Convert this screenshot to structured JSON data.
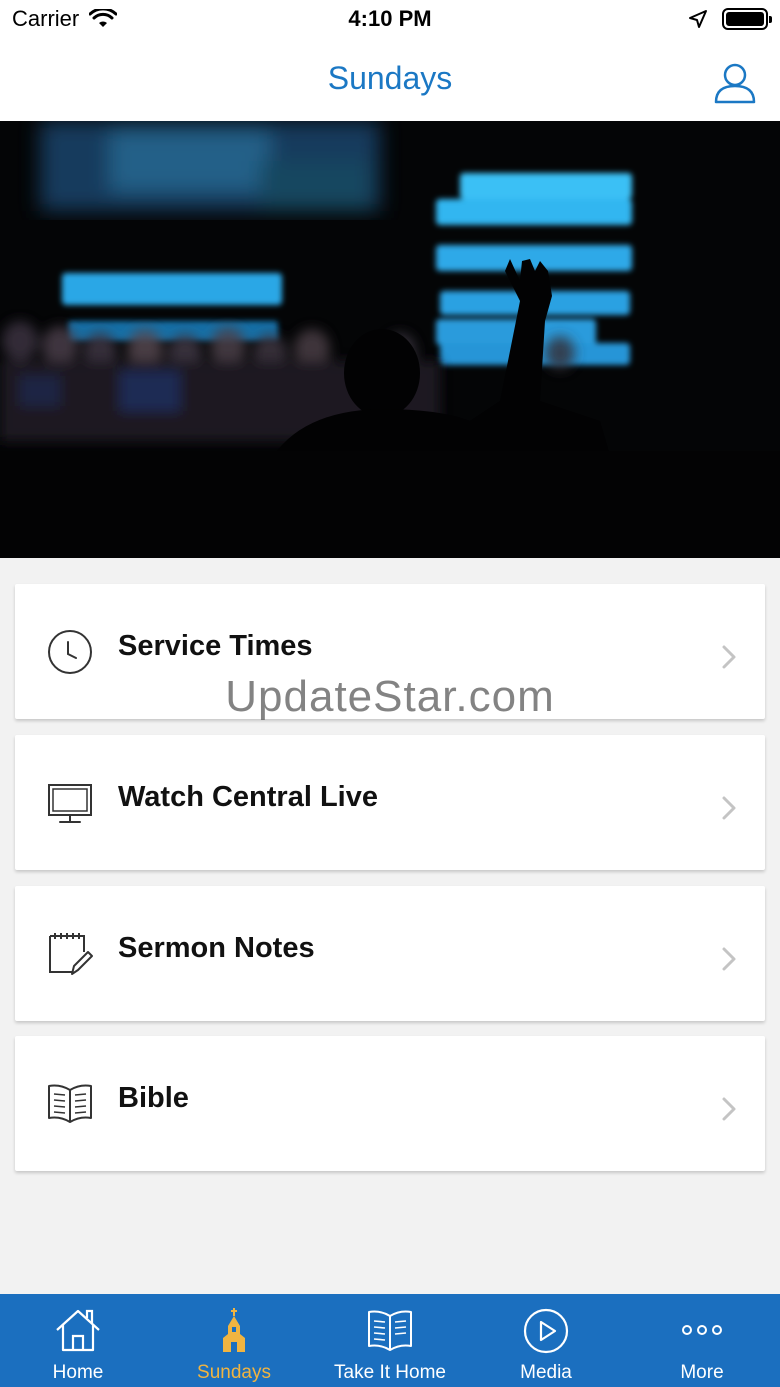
{
  "status_bar": {
    "carrier": "Carrier",
    "time": "4:10 PM"
  },
  "nav": {
    "title": "Sundays"
  },
  "hero": {
    "description": ""
  },
  "menu": [
    {
      "label": "Service Times",
      "icon": "clock-icon"
    },
    {
      "label": "Watch Central Live",
      "icon": "monitor-icon"
    },
    {
      "label": "Sermon Notes",
      "icon": "notepad-pencil-icon"
    },
    {
      "label": "Bible",
      "icon": "open-book-icon"
    }
  ],
  "watermark": "UpdateStar.com",
  "tabs": [
    {
      "label": "Home",
      "icon": "house-icon",
      "active": false
    },
    {
      "label": "Sundays",
      "icon": "church-icon",
      "active": true
    },
    {
      "label": "Take It Home",
      "icon": "book-icon",
      "active": false
    },
    {
      "label": "Media",
      "icon": "play-circle-icon",
      "active": false
    },
    {
      "label": "More",
      "icon": "more-dots-icon",
      "active": false
    }
  ],
  "colors": {
    "accent": "#1b78c4",
    "tab_bar": "#1b6fbf",
    "tab_active": "#f0b441",
    "background": "#f2f2f2"
  }
}
